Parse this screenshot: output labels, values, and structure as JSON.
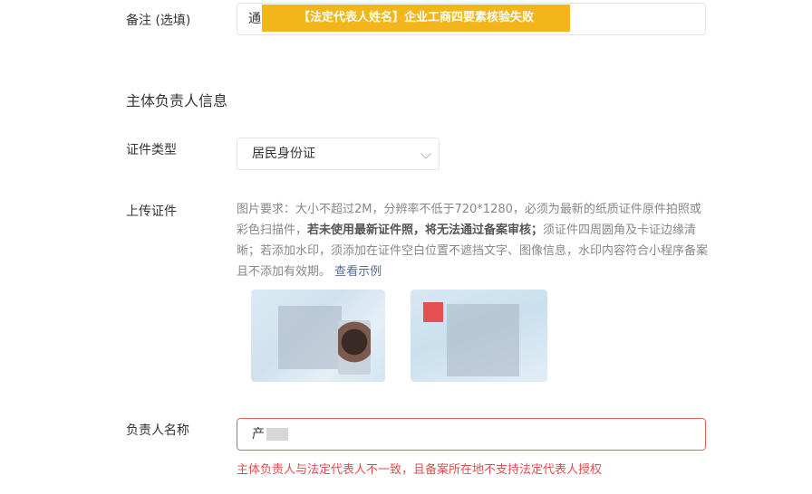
{
  "remark": {
    "label": "备注 (选填)",
    "value": "通",
    "banner": "【法定代表人姓名】企业工商四要素核验失败"
  },
  "principal": {
    "section_title": "主体负责人信息",
    "id_type": {
      "label": "证件类型",
      "selected": "居民身份证"
    },
    "upload": {
      "label": "上传证件",
      "tip_part1": "图片要求：大小不超过2M，分辨率不低于720*1280，必须为最新的纸质证件原件拍照或彩色扫描件，",
      "tip_bold": "若未使用最新证件照，将无法通过备案审核；",
      "tip_part2": "须证件四周圆角及卡证边缘清晰；若添加水印，须添加在证件空白位置不遮挡文字、图像信息，水印内容符合小程序备案且不添加有效期。",
      "tip_link": "查看示例"
    },
    "name": {
      "label": "负责人名称",
      "value": "产",
      "error": "主体负责人与法定代表人不一致，且备案所在地不支持法定代表人授权"
    }
  },
  "colors": {
    "banner": "#f2b51a",
    "error": "#e04f4f",
    "link": "#576b95"
  }
}
